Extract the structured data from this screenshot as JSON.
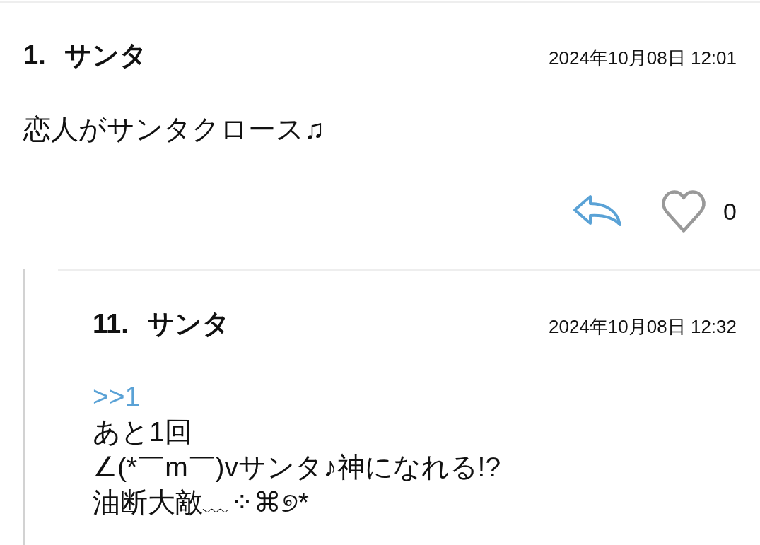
{
  "posts": [
    {
      "number": "1.",
      "author": "サンタ",
      "date": "2024年10月08日 12:01",
      "message": "恋人がサンタクロース♫",
      "liked": false,
      "like_count": "0",
      "replies": [
        {
          "number": "11.",
          "author": "サンタ",
          "date": "2024年10月08日 12:32",
          "quote": ">>1",
          "lines": [
            "あと1回",
            "∠(*￣m￣)vサンタ♪神になれる!?",
            "油断大敵﹏⁘⌘୭*"
          ]
        }
      ]
    }
  ]
}
